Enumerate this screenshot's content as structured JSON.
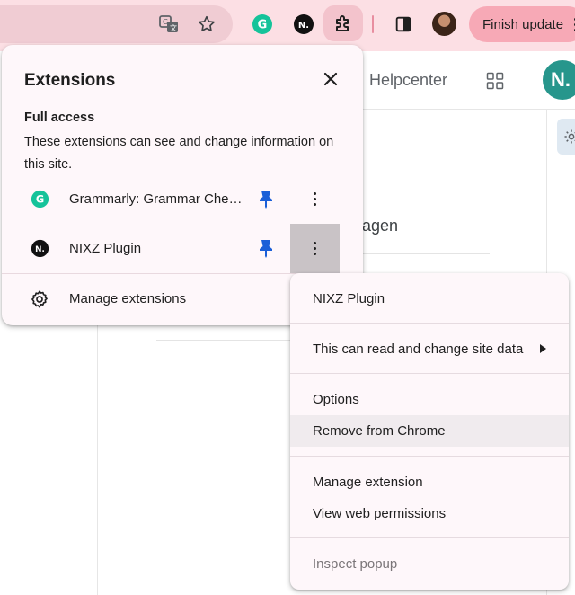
{
  "toolbar": {
    "finish_update_label": "Finish update",
    "grammarly_letter": "G",
    "nixz_letter": "N."
  },
  "page": {
    "helpcenter_label": "Helpcenter",
    "avatar_letter": "N.",
    "partial_text": "ragen"
  },
  "extensions_popup": {
    "title": "Extensions",
    "section_title": "Full access",
    "section_description": "These extensions can see and change information on this site.",
    "items": [
      {
        "name": "Grammarly: Grammar Chec...",
        "icon_letter": "G",
        "icon_color": "#15c39a"
      },
      {
        "name": "NIXZ Plugin",
        "icon_letter": "N.",
        "icon_color": "#111111"
      }
    ],
    "manage_label": "Manage extensions"
  },
  "context_menu": {
    "header": "NIXZ Plugin",
    "site_data_label": "This can read and change site data",
    "options_label": "Options",
    "remove_label": "Remove from Chrome",
    "manage_extension_label": "Manage extension",
    "view_permissions_label": "View web permissions",
    "inspect_popup_label": "Inspect popup"
  },
  "colors": {
    "toolbar_bg": "#fcdfe4",
    "pin_blue": "#1a5fd8",
    "avatar_teal": "#27968c",
    "popup_bg": "#fef7fa"
  }
}
